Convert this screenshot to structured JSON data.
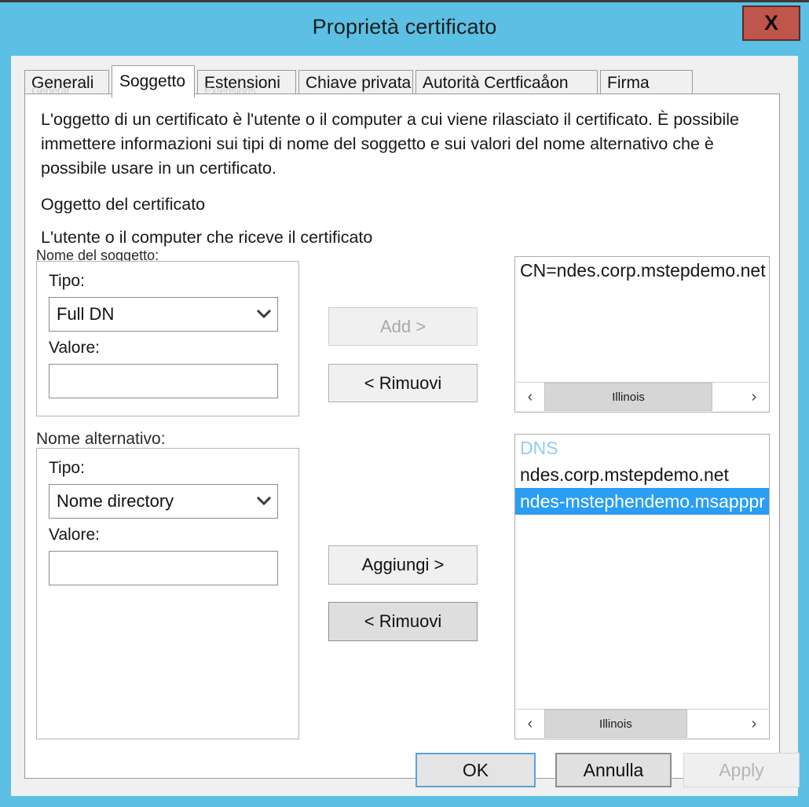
{
  "window": {
    "title": "Proprietà certificato",
    "close_label": "X",
    "title_bar_color": "#5bc0e3",
    "close_button_color": "#c0554c"
  },
  "tabs": [
    {
      "label": "Generali",
      "ghost": "General",
      "active": false
    },
    {
      "label": "Soggetto",
      "ghost": "",
      "active": true
    },
    {
      "label": "Estensioni",
      "ghost": "Extensions",
      "active": false
    },
    {
      "label": "Chiave privata",
      "ghost": "",
      "active": false
    },
    {
      "label": "Autorità Certficaåon",
      "ghost": "",
      "active": false
    },
    {
      "label": "Firma",
      "ghost": "",
      "active": false
    }
  ],
  "panel": {
    "intro": "L'oggetto di un certificato è l'utente o il computer a cui viene rilasciato il certificato. È possibile immettere informazioni sui tipi di nome del soggetto e sui valori del nome alternativo che è possibile usare in un certificato.",
    "heading": "Oggetto del certificato",
    "subheading": "L'utente o il computer che riceve il certificato"
  },
  "subject_name": {
    "group_label": "Nome del soggetto:",
    "type_label": "Tipo:",
    "type_value": "Full DN",
    "value_label": "Valore:",
    "value_text": "",
    "value_placeholder": ""
  },
  "alternative_name": {
    "group_label": "Nome alternativo:",
    "type_label": "Tipo:",
    "type_value": "Nome directory",
    "value_label": "Valore:",
    "value_text": "",
    "value_placeholder": ""
  },
  "subject_actions": {
    "add_label": "Add >",
    "add_disabled": true,
    "remove_label": "< Rimuovi",
    "remove_hovered": false
  },
  "alt_actions": {
    "add_label": "Aggiungi >",
    "add_disabled": false,
    "remove_label": "< Rimuovi",
    "remove_hovered": true
  },
  "subject_list": {
    "items": [
      {
        "text": "CN=ndes.corp.mstepdemo.net",
        "selected": false,
        "header": false
      }
    ],
    "scroll_left_glyph": "‹",
    "scroll_right_glyph": "›",
    "thumb_label": "Illinois",
    "thumb_width_pct": 86
  },
  "alt_list": {
    "items": [
      {
        "text": "DNS",
        "selected": false,
        "header": true
      },
      {
        "text": "ndes.corp.mstepdemo.net",
        "selected": false,
        "header": false
      },
      {
        "text": "ndes-mstephendemo.msapppr",
        "selected": true,
        "header": false
      }
    ],
    "scroll_left_glyph": "‹",
    "scroll_right_glyph": "›",
    "thumb_label": "Illinois",
    "thumb_width_pct": 73
  },
  "dialog_buttons": {
    "ok": "OK",
    "cancel": "Annulla",
    "apply": "Apply",
    "apply_disabled": true
  }
}
